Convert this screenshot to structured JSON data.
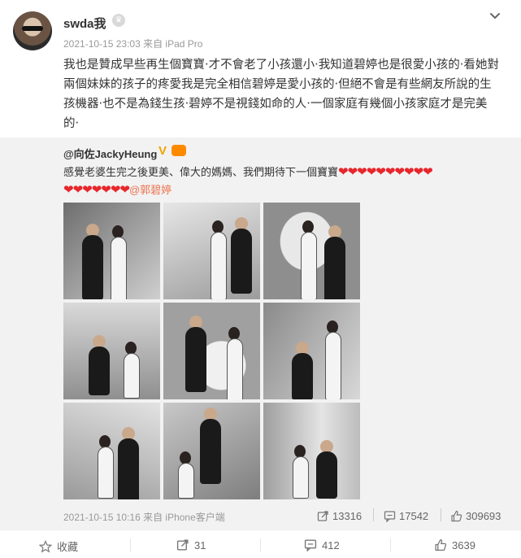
{
  "post": {
    "author": "swda我",
    "meta": "2021-10-15 23:03 来自 iPad Pro",
    "text": "我也是贊成早些再生個寶寶‧才不會老了小孩還小‧我知道碧婷也是很愛小孩的‧看她對兩個妹妹的孩子的疼愛我是完全相信碧婷是愛小孩的‧但絕不會是有些網友所說的生孩機器‧也不是為錢生孩‧碧婷不是視錢如命的人‧一個家庭有幾個小孩家庭才是完美的‧"
  },
  "repost": {
    "author": "@向佐JackyHeung",
    "text": "感覺老婆生完之後更美、偉大的媽媽、我們期待下一個寶寶",
    "hearts_line1": "❤❤❤❤❤❤❤❤❤❤",
    "hearts_line2": "❤❤❤❤❤❤❤",
    "mention": "@郭碧婷",
    "footer_meta": "2021-10-15 10:16 来自 iPhone客户端",
    "reposts": "13316",
    "comments": "17542",
    "likes": "309693",
    "photos": [
      {
        "name": "photo-1",
        "tone": "#9a9a9a"
      },
      {
        "name": "photo-2",
        "tone": "#c9c9c9"
      },
      {
        "name": "photo-3",
        "tone": "#b0b0b0"
      },
      {
        "name": "photo-4",
        "tone": "#bdbdbd"
      },
      {
        "name": "photo-5",
        "tone": "#d2d2d2"
      },
      {
        "name": "photo-6",
        "tone": "#a9a9a9"
      },
      {
        "name": "photo-7",
        "tone": "#c4c4c4"
      },
      {
        "name": "photo-8",
        "tone": "#b6b6b6"
      },
      {
        "name": "photo-9",
        "tone": "#cfcfcf"
      }
    ]
  },
  "actions": {
    "favorite_label": "收藏",
    "repost_count": "31",
    "comment_count": "412",
    "like_count": "3639"
  },
  "colors": {
    "heart": "#e8262b",
    "mention": "#eb7350",
    "repost_bg": "#f2f2f2"
  }
}
